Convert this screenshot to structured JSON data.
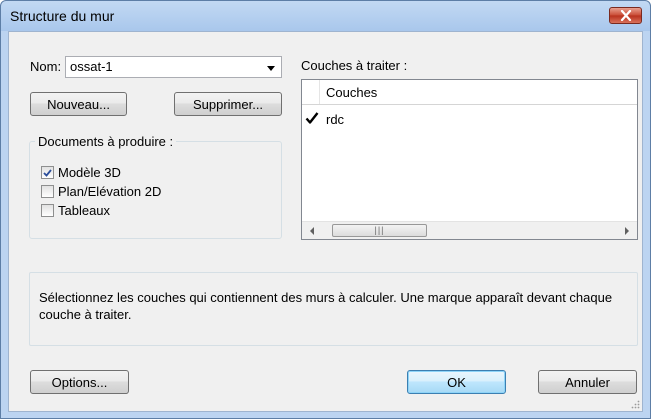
{
  "window": {
    "title": "Structure du mur"
  },
  "nom": {
    "label": "Nom:",
    "value": "ossat-1"
  },
  "buttons": {
    "nouveau": "Nouveau...",
    "supprimer": "Supprimer...",
    "options": "Options...",
    "ok": "OK",
    "annuler": "Annuler"
  },
  "documents": {
    "legend": "Documents à produire :",
    "items": [
      {
        "label": "Modèle 3D",
        "checked": true
      },
      {
        "label": "Plan/Elévation 2D",
        "checked": false
      },
      {
        "label": "Tableaux",
        "checked": false
      }
    ]
  },
  "couches": {
    "label": "Couches à traiter :",
    "column_header": "Couches",
    "rows": [
      {
        "name": "rdc",
        "checked": true
      }
    ]
  },
  "info_text": "Sélectionnez les couches qui contiennent des murs à calculer. Une marque apparaît devant chaque couche à traiter."
}
